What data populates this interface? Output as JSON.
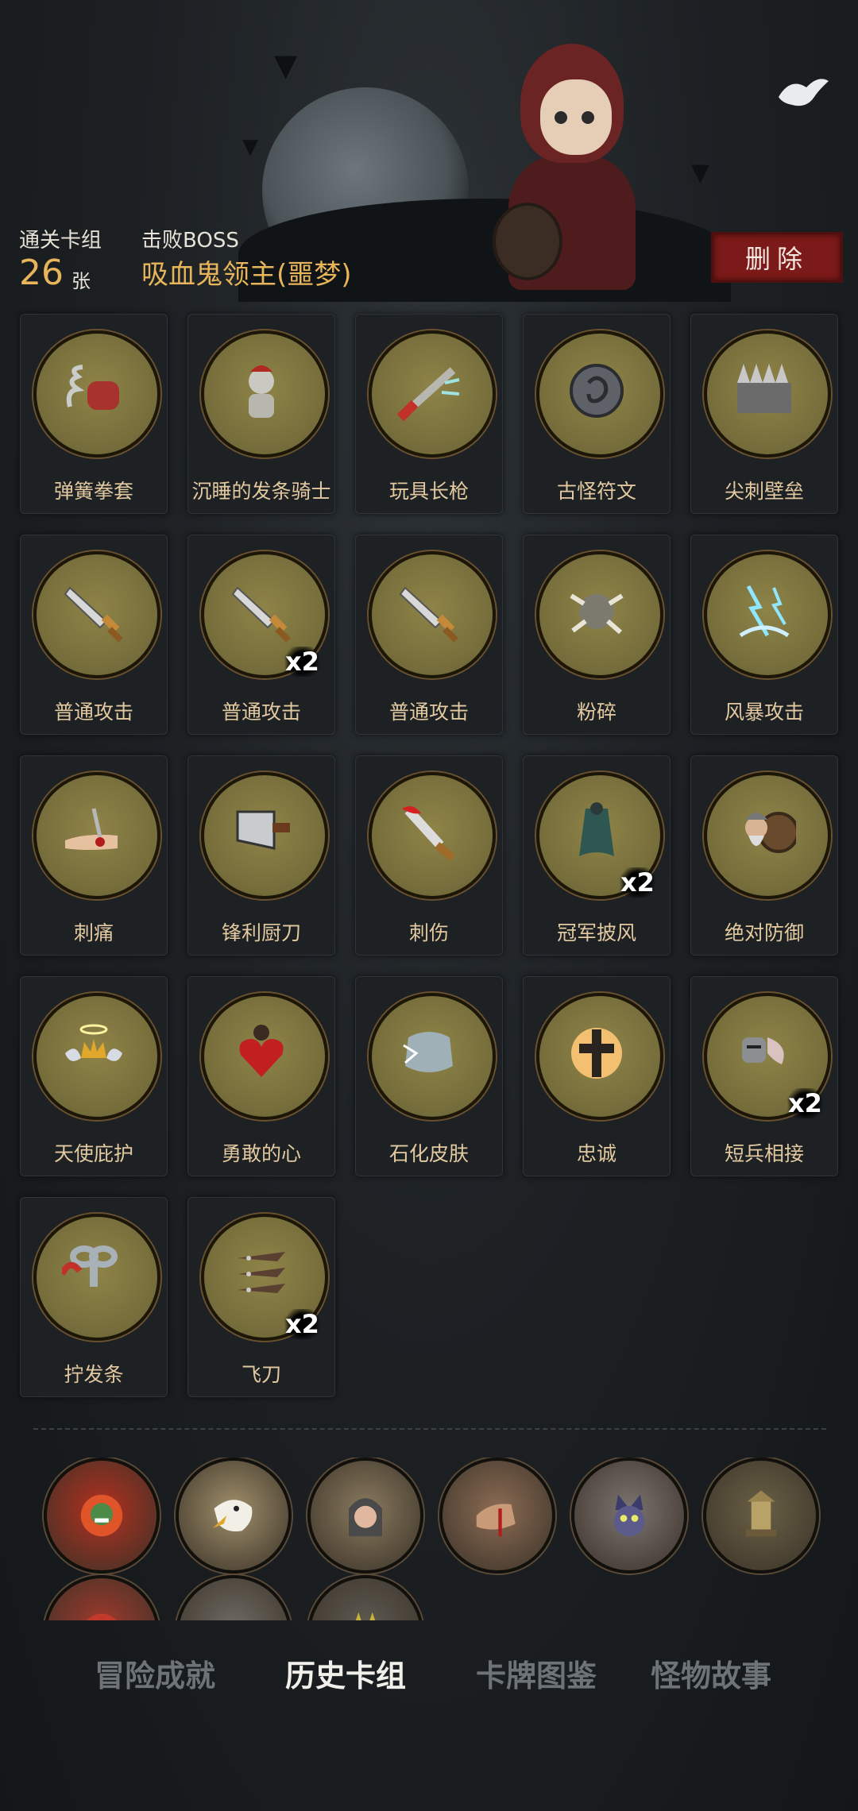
{
  "header": {
    "clear_deck_label": "通关卡组",
    "card_count": "26",
    "card_unit": "张",
    "defeated_label": "击败BOSS",
    "boss_name": "吸血鬼领主(噩梦)",
    "delete_label": "删除"
  },
  "cards": [
    {
      "name": "弹簧拳套",
      "icon": "spring-glove-icon"
    },
    {
      "name": "沉睡的发条骑士",
      "icon": "clockwork-knight-icon"
    },
    {
      "name": "玩具长枪",
      "icon": "toy-lance-icon"
    },
    {
      "name": "古怪符文",
      "icon": "rune-icon"
    },
    {
      "name": "尖刺壁垒",
      "icon": "spike-wall-icon"
    },
    {
      "name": "普通攻击",
      "icon": "sword-icon"
    },
    {
      "name": "普通攻击",
      "icon": "sword-icon",
      "multiplier": "x2"
    },
    {
      "name": "普通攻击",
      "icon": "sword-icon"
    },
    {
      "name": "粉碎",
      "icon": "smash-icon"
    },
    {
      "name": "风暴攻击",
      "icon": "storm-icon"
    },
    {
      "name": "刺痛",
      "icon": "sting-icon"
    },
    {
      "name": "锋利厨刀",
      "icon": "cleaver-icon"
    },
    {
      "name": "刺伤",
      "icon": "stab-icon"
    },
    {
      "name": "冠军披风",
      "icon": "cloak-icon",
      "multiplier": "x2"
    },
    {
      "name": "绝对防御",
      "icon": "dwarf-shield-icon"
    },
    {
      "name": "天使庇护",
      "icon": "angel-crown-icon"
    },
    {
      "name": "勇敢的心",
      "icon": "brave-heart-icon"
    },
    {
      "name": "石化皮肤",
      "icon": "stone-skin-icon"
    },
    {
      "name": "忠诚",
      "icon": "cross-icon"
    },
    {
      "name": "短兵相接",
      "icon": "knight-icon",
      "multiplier": "x2"
    },
    {
      "name": "拧发条",
      "icon": "wind-key-icon"
    },
    {
      "name": "飞刀",
      "icon": "throwing-knives-icon",
      "multiplier": "x2"
    }
  ],
  "monsters": [
    {
      "icon": "fire-demon-icon",
      "color": "#b3301e"
    },
    {
      "icon": "eagle-icon",
      "color": "#a08f6a"
    },
    {
      "icon": "hooded-elder-icon",
      "color": "#8a7a5e"
    },
    {
      "icon": "bloody-hand-icon",
      "color": "#8c6c54"
    },
    {
      "icon": "witch-cat-icon",
      "color": "#7c7470"
    },
    {
      "icon": "idol-statue-icon",
      "color": "#6a6046"
    },
    {
      "icon": "red-beast-icon",
      "color": "#a2392c"
    },
    {
      "icon": "helmet-warrior-icon",
      "color": "#6e6a62"
    },
    {
      "icon": "jester-icon",
      "color": "#5e5a52"
    }
  ],
  "tabs": [
    {
      "label": "冒险成就",
      "active": false
    },
    {
      "label": "历史卡组",
      "active": true
    },
    {
      "label": "卡牌图鉴",
      "active": false
    },
    {
      "label": "怪物故事",
      "active": false
    }
  ]
}
